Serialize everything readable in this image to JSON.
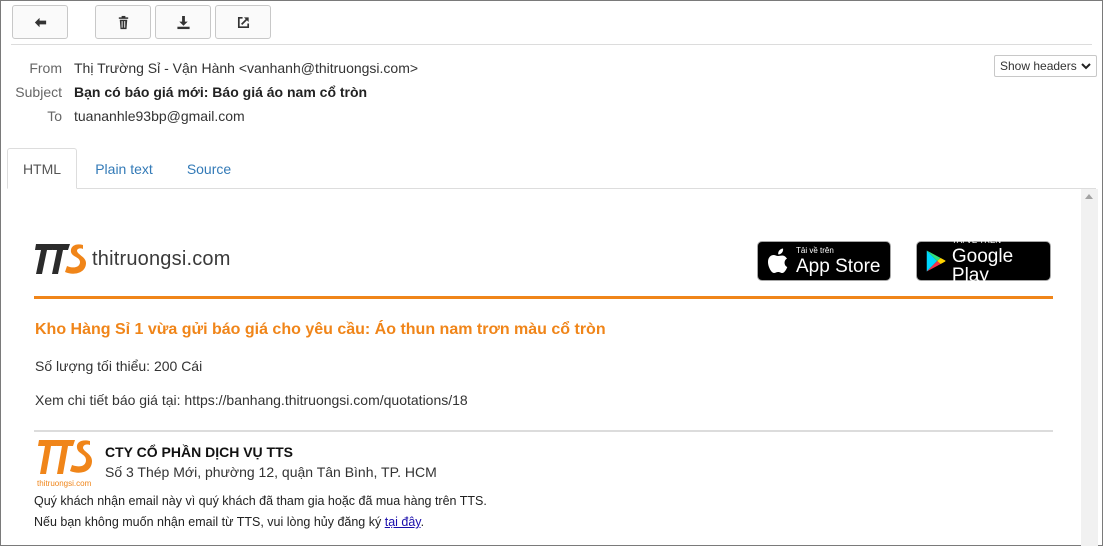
{
  "toolbar": {
    "back": "back-arrow-icon",
    "delete": "trash-icon",
    "download": "download-icon",
    "open_external": "external-link-icon"
  },
  "headers": {
    "from_label": "From",
    "from_value": "Thị Trường Sỉ - Vận Hành <vanhanh@thitruongsi.com>",
    "subject_label": "Subject",
    "subject_value": "Bạn có báo giá mới: Báo giá áo nam cổ tròn",
    "to_label": "To",
    "to_value": "tuananhle93bp@gmail.com",
    "show_headers_label": "Show headers"
  },
  "tabs": [
    {
      "label": "HTML",
      "active": true
    },
    {
      "label": "Plain text",
      "active": false
    },
    {
      "label": "Source",
      "active": false
    }
  ],
  "email": {
    "logo_mark": "TTS",
    "logo_text": "thitruongsi.com",
    "app_store": {
      "small": "Tải về trên",
      "big": "App Store"
    },
    "google_play": {
      "small": "TẢI VỀ TRÊN",
      "big": "Google Play"
    },
    "quote_title": "Kho Hàng Sỉ 1 vừa gửi báo giá cho yêu cầu: Áo thun nam trơn màu cổ tròn",
    "min_qty": "Số lượng tối thiểu: 200 Cái",
    "detail_line": "Xem chi tiết báo giá tại: https://banhang.thitruongsi.com/quotations/18",
    "footer_logo_caption": "thitruongsi.com",
    "company_name": "CTY CỔ PHẦN DỊCH VỤ TTS",
    "company_address": "Số 3 Thép Mới, phường 12, quận Tân Bình, TP. HCM",
    "notice_line": "Quý khách nhận email này vì quý khách đã tham gia hoặc đã mua hàng trên TTS.",
    "unsub_prefix": "Nếu bạn không muốn nhận email từ TTS, vui lòng hủy đăng ký ",
    "unsub_link": "tại đây",
    "unsub_suffix": "."
  },
  "colors": {
    "brand_orange": "#f08519",
    "link_blue": "#337ab7",
    "logo_dark": "#2b2b2b"
  }
}
